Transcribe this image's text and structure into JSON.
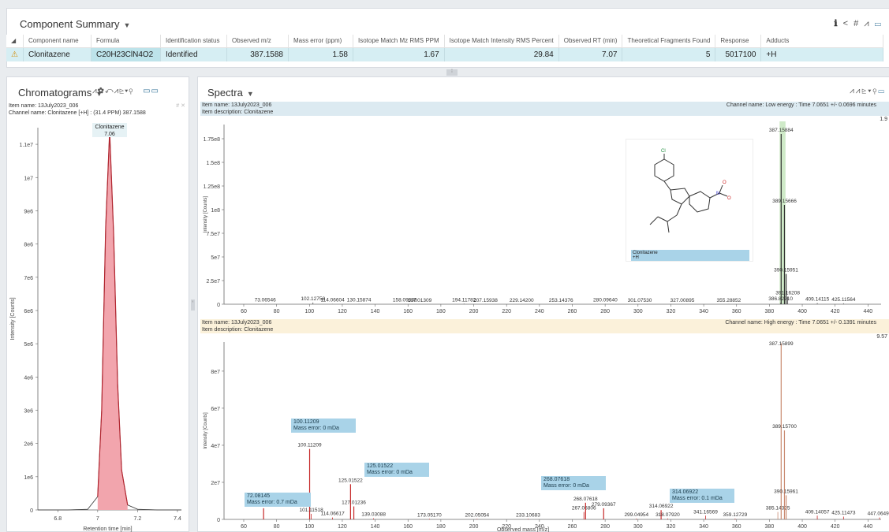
{
  "summary": {
    "title": "Component Summary",
    "toolbar_icons": [
      "info-icon",
      "share-icon",
      "hash-icon",
      "peak-icon",
      "layout-icon"
    ],
    "columns": [
      "Component name",
      "Formula",
      "Identification status",
      "Observed m/z",
      "Mass error (ppm)",
      "Isotope Match Mz RMS PPM",
      "Isotope Match Intensity RMS Percent",
      "Observed RT (min)",
      "Theoretical Fragments Found",
      "Response",
      "Adducts"
    ],
    "row": {
      "name": "Clonitazene",
      "formula": "C20H23ClN4O2",
      "status": "Identified",
      "mz": "387.1588",
      "mass_error": "1.58",
      "iso_mz": "1.67",
      "iso_int": "29.84",
      "rt": "7.07",
      "fragments": "5",
      "response": "5017100",
      "adducts": "+H"
    }
  },
  "chrom": {
    "title": "Chromatograms",
    "item_name": "Item name: 13July2023_006",
    "channel": "Channel name: Clonitazene [+H] : (31.4 PPM) 387.1588",
    "peak_label_name": "Clonitazene",
    "peak_label_rt": "7.06",
    "ylabel": "Intensity [Counts]",
    "xlabel": "Retention time [min]",
    "yticks": [
      "1.1e7",
      "1e7",
      "9e6",
      "8e6",
      "7e6",
      "6e6",
      "5e6",
      "4e6",
      "3e6",
      "2e6",
      "1e6",
      "0"
    ],
    "xticks": [
      "6.8",
      "7",
      "7.2",
      "7.4"
    ]
  },
  "spectra": {
    "title": "Spectra",
    "low": {
      "item_name": "Item name: 13July2023_006",
      "item_desc": "Item description: Clonitazene",
      "channel": "Channel name: Low energy : Time 7.0651 +/- 0.0696 minutes",
      "max": "1.9",
      "yticks": [
        "1.75e8",
        "1.5e8",
        "1.25e8",
        "1e8",
        "7.5e7",
        "5e7",
        "2.5e7",
        "0"
      ],
      "ylabel": "Intensity [Counts]",
      "structure_caption_1": "Clonitazene",
      "structure_caption_2": "+H"
    },
    "high": {
      "item_name": "Item name: 13July2023_006",
      "item_desc": "Item description: Clonitazene",
      "channel": "Channel name: High energy : Time 7.0651 +/- 0.1391 minutes",
      "max": "9.57",
      "yticks": [
        "8e7",
        "6e7",
        "4e7",
        "2e7",
        "0"
      ],
      "ylabel": "Intensity [Counts]",
      "xlabel": "Observed mass [m/z]",
      "fragments": [
        {
          "mz": "100.11209",
          "err": "Mass error: 0 mDa"
        },
        {
          "mz": "125.01522",
          "err": "Mass error: 0 mDa"
        },
        {
          "mz": "72.08145",
          "err": "Mass error: 0.7 mDa"
        },
        {
          "mz": "268.07618",
          "err": "Mass error: 0 mDa"
        },
        {
          "mz": "314.06922",
          "err": "Mass error: 0.1 mDa"
        }
      ]
    },
    "xticks": [
      "60",
      "80",
      "100",
      "120",
      "140",
      "160",
      "180",
      "200",
      "220",
      "240",
      "260",
      "280",
      "300",
      "320",
      "340",
      "360",
      "380",
      "400",
      "420",
      "440"
    ]
  },
  "chart_data": [
    {
      "type": "line",
      "title": "Clonitazene",
      "xlabel": "Retention time [min]",
      "ylabel": "Intensity [Counts]",
      "xlim": [
        6.7,
        7.42
      ],
      "ylim": [
        0,
        11500000
      ],
      "series": [
        {
          "name": "Clonitazene",
          "x": [
            6.7,
            6.85,
            6.95,
            7.0,
            7.02,
            7.04,
            7.06,
            7.08,
            7.1,
            7.12,
            7.15,
            7.2,
            7.3,
            7.42
          ],
          "y": [
            0,
            0,
            20000,
            400000,
            3000000,
            8500000,
            11400000,
            8300000,
            3800000,
            1200000,
            150000,
            20000,
            0,
            0
          ]
        }
      ],
      "peak": {
        "rt": 7.06
      }
    },
    {
      "type": "bar",
      "title": "Low energy",
      "xlabel": "Observed mass [m/z]",
      "ylabel": "Intensity [Counts]",
      "xlim": [
        48,
        448
      ],
      "ylim": [
        0,
        190000000
      ],
      "labels": [
        {
          "x": 73.06546,
          "y": 300000
        },
        {
          "x": 102.12758,
          "y": 1800000
        },
        {
          "x": 114.06604,
          "y": 300000
        },
        {
          "x": 130.15874,
          "y": 400000
        },
        {
          "x": 158.09639,
          "y": 300000
        },
        {
          "x": 167.01309,
          "y": 150000
        },
        {
          "x": 194.11782,
          "y": 600000
        },
        {
          "x": 207.15938,
          "y": 200000
        },
        {
          "x": 229.142,
          "y": 150000
        },
        {
          "x": 253.14376,
          "y": 150000
        },
        {
          "x": 280.0964,
          "y": 300000
        },
        {
          "x": 301.0753,
          "y": 150000
        },
        {
          "x": 327.00895,
          "y": 150000
        },
        {
          "x": 355.28852,
          "y": 200000
        },
        {
          "x": 386.8291,
          "y": 1500000
        },
        {
          "x": 387.15884,
          "y": 180000000
        },
        {
          "x": 389.15666,
          "y": 105000000
        },
        {
          "x": 390.15951,
          "y": 32000000
        },
        {
          "x": 391.16208,
          "y": 8000000
        },
        {
          "x": 409.14115,
          "y": 1200000
        },
        {
          "x": 425.11564,
          "y": 1000000
        }
      ]
    },
    {
      "type": "bar",
      "title": "High energy",
      "xlabel": "Observed mass [m/z]",
      "ylabel": "Intensity [Counts]",
      "xlim": [
        48,
        448
      ],
      "ylim": [
        0,
        95700000
      ],
      "labels": [
        {
          "x": 72.08145,
          "y": 6000000
        },
        {
          "x": 100.11209,
          "y": 38000000
        },
        {
          "x": 101.11518,
          "y": 3000000
        },
        {
          "x": 114.06617,
          "y": 1000000
        },
        {
          "x": 125.01522,
          "y": 19000000
        },
        {
          "x": 127.01236,
          "y": 7000000
        },
        {
          "x": 139.03088,
          "y": 600000
        },
        {
          "x": 173.0517,
          "y": 300000
        },
        {
          "x": 202.05054,
          "y": 300000
        },
        {
          "x": 233.10683,
          "y": 300000
        },
        {
          "x": 267.06806,
          "y": 4000000
        },
        {
          "x": 268.07618,
          "y": 9000000
        },
        {
          "x": 279.09367,
          "y": 6000000
        },
        {
          "x": 299.04954,
          "y": 400000
        },
        {
          "x": 314.06922,
          "y": 5000000
        },
        {
          "x": 318.0792,
          "y": 500000
        },
        {
          "x": 341.16569,
          "y": 2000000
        },
        {
          "x": 359.12729,
          "y": 400000
        },
        {
          "x": 385.14325,
          "y": 4000000
        },
        {
          "x": 387.15899,
          "y": 95000000
        },
        {
          "x": 389.157,
          "y": 48000000
        },
        {
          "x": 390.15961,
          "y": 13000000
        },
        {
          "x": 409.14057,
          "y": 2000000
        },
        {
          "x": 425.11473,
          "y": 1500000
        },
        {
          "x": 447.06492,
          "y": 1000000
        }
      ]
    }
  ],
  "colors": {
    "accent": "#2f6f96",
    "row": "#d6eef3",
    "peak": "#b32630",
    "peak_fill": "#f2a5ad",
    "label_bg": "#a9d3e8",
    "highlight": "#a8d99a"
  }
}
